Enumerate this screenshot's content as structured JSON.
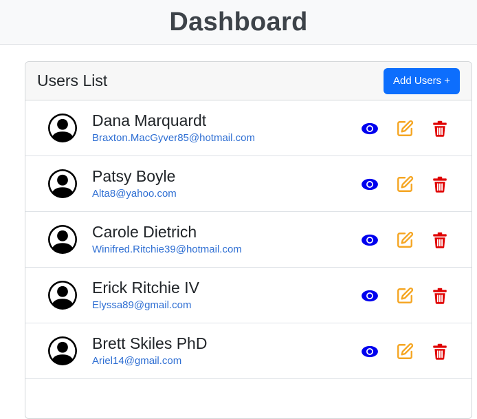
{
  "page": {
    "title": "Dashboard"
  },
  "users_card": {
    "title": "Users List",
    "add_button": "Add Users +"
  },
  "colors": {
    "view": "#0000ee",
    "edit": "#f5a623",
    "delete": "#e00000",
    "email": "#2f6fd3",
    "primary_button": "#0d6efd"
  },
  "icons": {
    "avatar": "person-circle-icon",
    "view": "eye-icon",
    "edit": "pencil-square-icon",
    "delete": "trash-icon"
  },
  "users": [
    {
      "name": "Dana Marquardt",
      "email": "Braxton.MacGyver85@hotmail.com"
    },
    {
      "name": "Patsy Boyle",
      "email": "Alta8@yahoo.com"
    },
    {
      "name": "Carole Dietrich",
      "email": "Winifred.Ritchie39@hotmail.com"
    },
    {
      "name": "Erick Ritchie IV",
      "email": "Elyssa89@gmail.com"
    },
    {
      "name": "Brett Skiles PhD",
      "email": "Ariel14@gmail.com"
    }
  ]
}
